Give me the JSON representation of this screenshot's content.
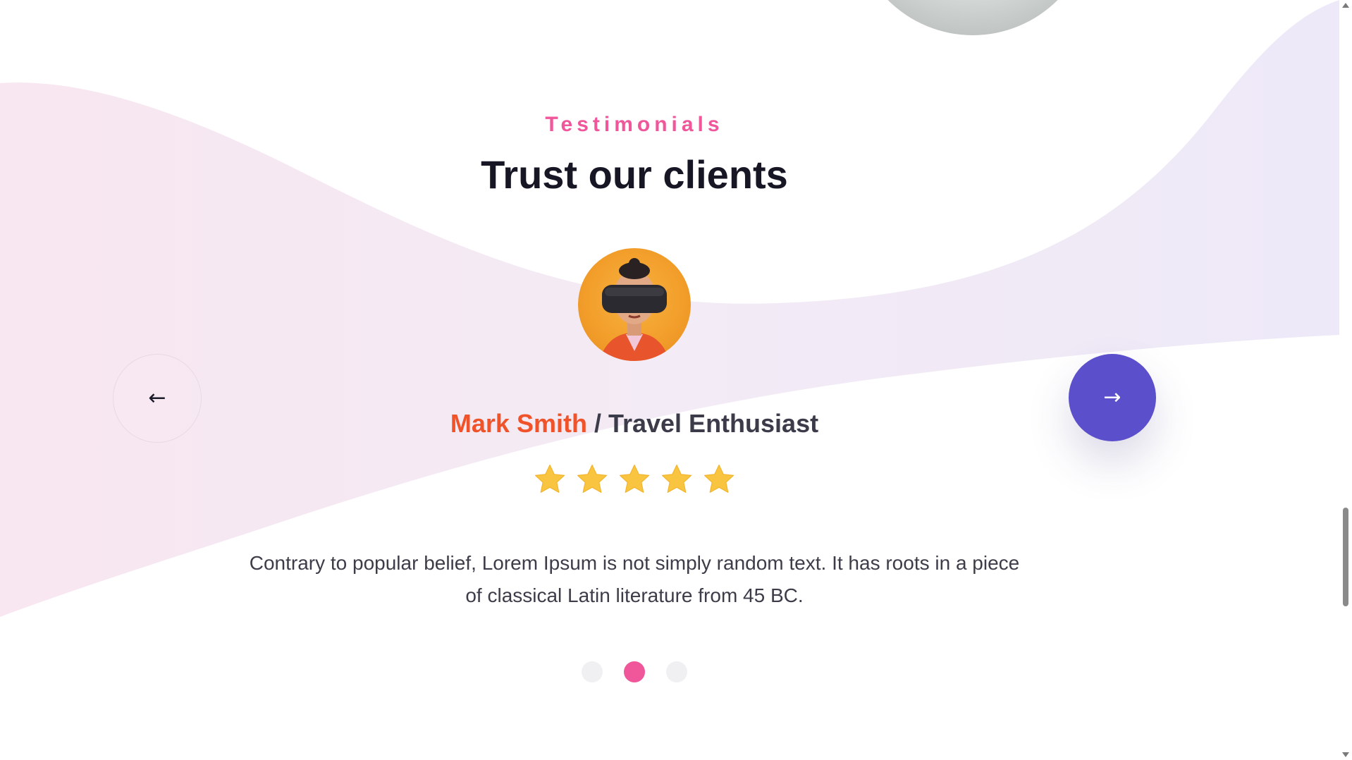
{
  "section": {
    "eyebrow": "Testimonials",
    "heading": "Trust our clients"
  },
  "testimonial": {
    "name": "Mark Smith",
    "separator": " / ",
    "role": "Travel Enthusiast",
    "rating": 5,
    "rating_max": 5,
    "quote": "Contrary to popular belief, Lorem Ipsum is not simply random text. It has roots in a piece of classical Latin literature from 45 BC."
  },
  "navigation": {
    "prev_icon": "arrow-left-icon",
    "prev_glyph": "←",
    "next_icon": "arrow-right-icon",
    "next_glyph": "→"
  },
  "pagination": {
    "count": 3,
    "active_index": 1
  },
  "colors": {
    "accent_pink": "#f0569a",
    "name_orange": "#f0532a",
    "next_button": "#5b4fcb",
    "star": "#f9c440",
    "heading": "#161625"
  }
}
